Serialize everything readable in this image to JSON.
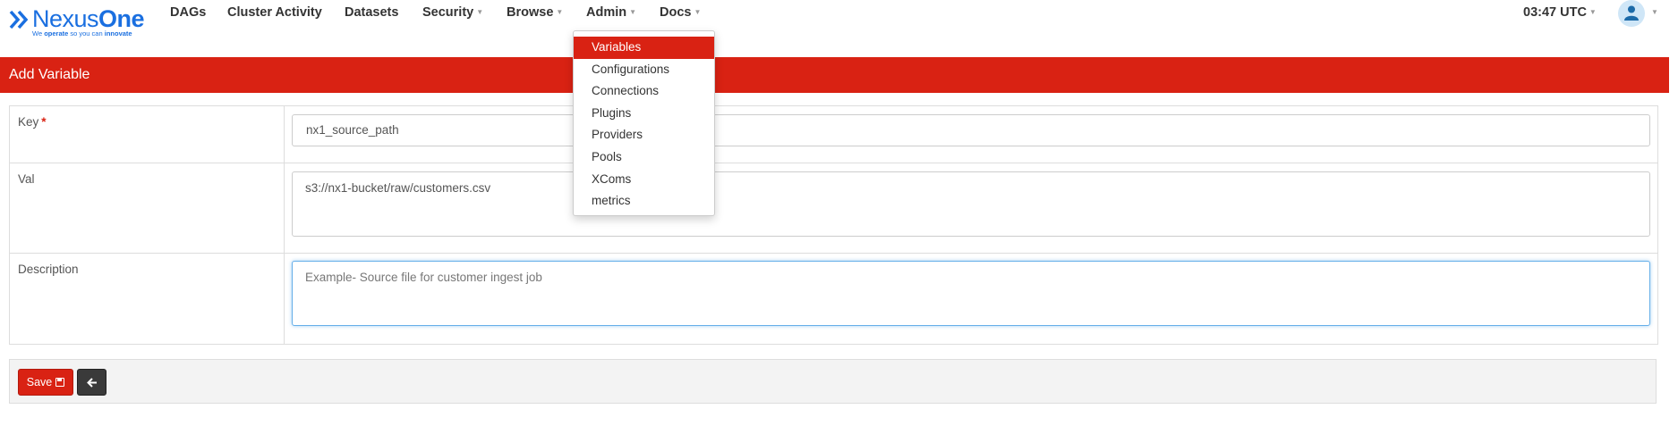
{
  "brand": {
    "name_light": "Nexus",
    "name_bold": "One",
    "tagline_pre": "We ",
    "tagline_bold1": "operate",
    "tagline_mid": " so you can ",
    "tagline_bold2": "innovate",
    "logo_icon": "double-chevron-icon",
    "color": "#1a6fe0"
  },
  "nav": {
    "items": [
      {
        "label": "DAGs"
      },
      {
        "label": "Cluster Activity"
      },
      {
        "label": "Datasets"
      },
      {
        "label": "Security"
      },
      {
        "label": "Browse"
      },
      {
        "label": "Admin"
      },
      {
        "label": "Docs"
      }
    ],
    "time": "03:47 UTC",
    "user_icon": "user-icon"
  },
  "admin_menu": {
    "items": [
      {
        "label": "Variables",
        "active": true
      },
      {
        "label": "Configurations"
      },
      {
        "label": "Connections"
      },
      {
        "label": "Plugins"
      },
      {
        "label": "Providers"
      },
      {
        "label": "Pools"
      },
      {
        "label": "XComs"
      },
      {
        "label": "metrics"
      }
    ]
  },
  "panel": {
    "title": "Add Variable",
    "accent_color": "#d92213"
  },
  "form": {
    "key_label": "Key",
    "required_mark": "*",
    "key_value": "nx1_source_path",
    "val_label": "Val",
    "val_value": "s3://nx1-bucket/raw/customers.csv",
    "description_label": "Description",
    "description_placeholder": "Example- Source file for customer ingest job"
  },
  "actions": {
    "save_label": "Save",
    "save_icon": "save-icon",
    "back_icon": "arrow-left-icon"
  }
}
